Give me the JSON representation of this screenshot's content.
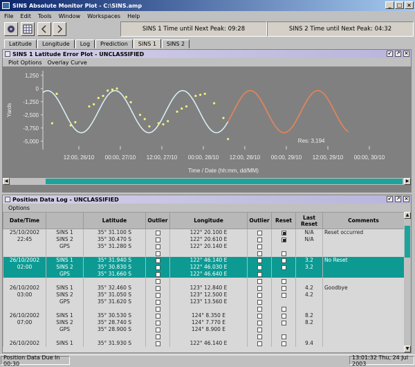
{
  "window": {
    "title": "SINS Absolute Monitor Plot - C:\\SINS.amp"
  },
  "menu": [
    "File",
    "Edit",
    "Tools",
    "Window",
    "Workspaces",
    "Help"
  ],
  "toolbar": {
    "peak1": "SINS 1 Time until Next Peak: 09:28",
    "peak2": "SINS 2 Time until Next Peak: 04:32"
  },
  "tabs": [
    "Latitude",
    "Longitude",
    "Log",
    "Prediction",
    "SINS 1",
    "SINS 2"
  ],
  "active_tab": "SINS 1",
  "plot_panel": {
    "title": "SINS 1 Latitude Error Plot - UNCLASSIFIED",
    "menu": [
      "Plot Options",
      "Overlay Curve"
    ]
  },
  "chart_data": {
    "type": "line",
    "ylabel": "Yards",
    "xlabel": "Time / Date  (hh:mm, dd/MM)",
    "yticks": [
      "1,250",
      "0",
      "-1,250",
      "-2,500",
      "-3,750",
      "-5,000"
    ],
    "ytick_values": [
      1250,
      0,
      -1250,
      -2500,
      -3750,
      -5000
    ],
    "ylim": [
      -5800,
      1700
    ],
    "xticks": [
      "12:00, 26/10",
      "00:00, 27/10",
      "12:00, 27/10",
      "00:00, 28/10",
      "12:00, 28/10",
      "00:00, 29/10",
      "12:00, 29/10",
      "00:00, 30/10"
    ],
    "annotation": "Res: 3,194",
    "colors": {
      "fit": "#d8eef0",
      "prediction": "#e0845a",
      "points": "#f2f27a",
      "background": "#808080"
    },
    "points": [
      [
        2,
        -3300
      ],
      [
        3,
        -500
      ],
      [
        6,
        -3500
      ],
      [
        7,
        -3200
      ],
      [
        10,
        -1700
      ],
      [
        11,
        -1500
      ],
      [
        12,
        -900
      ],
      [
        13,
        -700
      ],
      [
        14,
        -200
      ],
      [
        15,
        -100
      ],
      [
        16,
        0
      ],
      [
        18,
        -800
      ],
      [
        19,
        -1300
      ],
      [
        21,
        -2500
      ],
      [
        22,
        -2900
      ],
      [
        23,
        -3600
      ],
      [
        25,
        -3300
      ],
      [
        26,
        -3400
      ],
      [
        27,
        -3100
      ],
      [
        29,
        -2200
      ],
      [
        30,
        -1900
      ],
      [
        31,
        -1700
      ],
      [
        33,
        -700
      ],
      [
        34,
        -600
      ],
      [
        35,
        -500
      ],
      [
        37,
        -1400
      ],
      [
        39,
        -2800
      ],
      [
        40,
        -4800
      ]
    ],
    "fit": {
      "center": -2200,
      "amplitude": 2000,
      "period": 14.6,
      "peak_at": 15.6,
      "fit_end": 40,
      "predict_end": 66,
      "x_max": 78
    }
  },
  "log_panel": {
    "title": "Position Data Log - UNCLASSIFIED",
    "menu": [
      "Options"
    ],
    "columns": [
      "Date/Time",
      "",
      "Latitude",
      "Outlier",
      "Longitude",
      "Outlier",
      "Reset",
      "Last Reset",
      "Comments"
    ],
    "rows": [
      {
        "dt": "25/10/2002",
        "sins": "SINS 1",
        "lat": "35° 31.100 S",
        "o1": false,
        "lon": "122° 20.100 E",
        "o2": false,
        "reset": true,
        "last": "N/A",
        "comment": "Reset occurred",
        "sel": false
      },
      {
        "dt": "22:45",
        "sins": "SINS 2",
        "lat": "35° 30.470 S",
        "o1": false,
        "lon": "122° 20.610 E",
        "o2": false,
        "reset": true,
        "last": "N/A",
        "comment": "",
        "sel": false
      },
      {
        "dt": "",
        "sins": "GPS",
        "lat": "35° 31.280 S",
        "o1": false,
        "lon": "122° 20.140 E",
        "o2": false,
        "reset": null,
        "last": "",
        "comment": "",
        "sel": false
      },
      {
        "dt": "",
        "sins": "",
        "lat": "",
        "o1": false,
        "lon": "",
        "o2": false,
        "reset": null,
        "last": "",
        "comment": "",
        "sel": false
      },
      {
        "dt": "26/10/2002",
        "sins": "SINS 1",
        "lat": "35° 31.940 S",
        "o1": false,
        "lon": "122° 46.140 E",
        "o2": false,
        "reset": false,
        "last": "3.2",
        "comment": "No Reset",
        "sel": true
      },
      {
        "dt": "02:00",
        "sins": "SINS 2",
        "lat": "35° 30.830 S",
        "o1": false,
        "lon": "122° 46.030 E",
        "o2": false,
        "reset": false,
        "last": "3.2",
        "comment": "",
        "sel": true
      },
      {
        "dt": "",
        "sins": "GPS",
        "lat": "35° 31.660 S",
        "o1": false,
        "lon": "122° 46.640 E",
        "o2": false,
        "reset": null,
        "last": "",
        "comment": "",
        "sel": true
      },
      {
        "dt": "",
        "sins": "",
        "lat": "",
        "o1": false,
        "lon": "",
        "o2": false,
        "reset": null,
        "last": "",
        "comment": "",
        "sel": false
      },
      {
        "dt": "26/10/2002",
        "sins": "SINS 1",
        "lat": "35° 32.460 S",
        "o1": false,
        "lon": "123° 12.840 E",
        "o2": false,
        "reset": false,
        "last": "4.2",
        "comment": "Goodbye",
        "sel": false
      },
      {
        "dt": "03:00",
        "sins": "SINS 2",
        "lat": "35° 31.050 S",
        "o1": false,
        "lon": "123° 12.500 E",
        "o2": false,
        "reset": false,
        "last": "4.2",
        "comment": "",
        "sel": false
      },
      {
        "dt": "",
        "sins": "GPS",
        "lat": "35° 31.620 S",
        "o1": false,
        "lon": "123° 13.560 E",
        "o2": false,
        "reset": null,
        "last": "",
        "comment": "",
        "sel": false
      },
      {
        "dt": "",
        "sins": "",
        "lat": "",
        "o1": false,
        "lon": "",
        "o2": false,
        "reset": null,
        "last": "",
        "comment": "",
        "sel": false
      },
      {
        "dt": "26/10/2002",
        "sins": "SINS 1",
        "lat": "35° 30.530 S",
        "o1": false,
        "lon": "124° 8.350 E",
        "o2": false,
        "reset": false,
        "last": "8.2",
        "comment": "",
        "sel": false
      },
      {
        "dt": "07:00",
        "sins": "SINS 2",
        "lat": "35° 28.740 S",
        "o1": false,
        "lon": "124° 7.770 E",
        "o2": false,
        "reset": false,
        "last": "8.2",
        "comment": "",
        "sel": false
      },
      {
        "dt": "",
        "sins": "GPS",
        "lat": "35° 28.900 S",
        "o1": false,
        "lon": "124° 8.900 E",
        "o2": false,
        "reset": null,
        "last": "",
        "comment": "",
        "sel": false
      },
      {
        "dt": "",
        "sins": "",
        "lat": "",
        "o1": false,
        "lon": "",
        "o2": false,
        "reset": null,
        "last": "",
        "comment": "",
        "sel": false
      },
      {
        "dt": "26/10/2002",
        "sins": "SINS 1",
        "lat": "35° 31.930 S",
        "o1": false,
        "lon": "122° 46.140 E",
        "o2": false,
        "reset": false,
        "last": "9.4",
        "comment": "",
        "sel": false
      }
    ]
  },
  "status": {
    "left": "Position Data Due In 00:30",
    "right": "13:01:32 Thu, 24 Jul 2003"
  }
}
